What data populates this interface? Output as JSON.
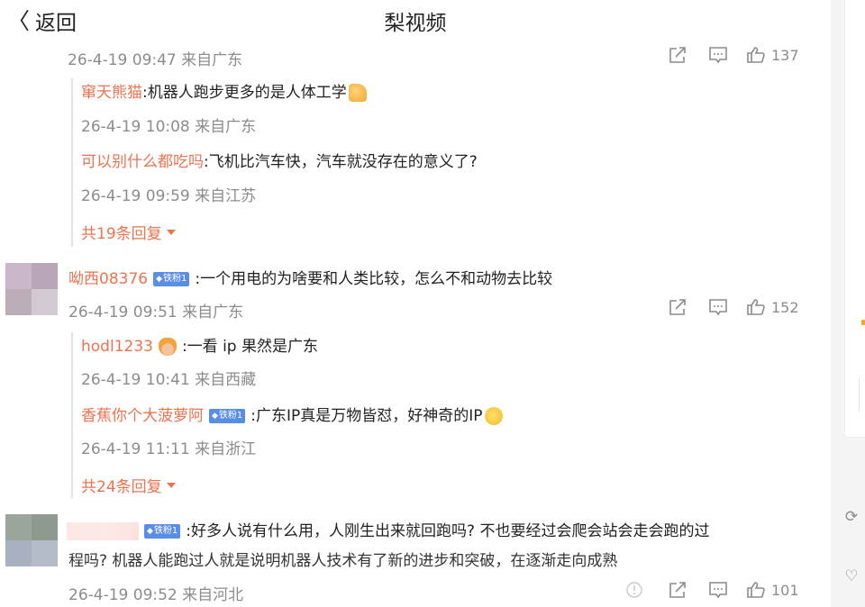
{
  "header": {
    "back_label": "返回",
    "title": "梨视频"
  },
  "comment1": {
    "time": "26-4-19 09:47 来自广东",
    "likes": "137",
    "replies": [
      {
        "name": "窜天熊猫",
        "text": ":机器人跑步更多的是人体工学",
        "time": "26-4-19 10:08 来自广东"
      },
      {
        "name": "可以别什么都吃吗",
        "text": ":飞机比汽车快，汽车就没存在的意义了?",
        "time": "26-4-19 09:59 来自江苏"
      }
    ],
    "more": "共19条回复"
  },
  "comment2": {
    "name": "呦西08376",
    "badge": "铁粉1",
    "text": ":一个用电的为啥要和人类比较，怎么不和动物去比较",
    "time": "26-4-19 09:51 来自广东",
    "likes": "152",
    "replies": [
      {
        "name": "hodl1233",
        "text": ":一看 ip 果然是广东",
        "time": "26-4-19 10:41 来自西藏"
      },
      {
        "name": "香蕉你个大菠萝阿",
        "badge": "铁粉1",
        "text": ":广东IP真是万物皆怼，好神奇的IP",
        "time": "26-4-19 11:11 来自浙江"
      }
    ],
    "more": "共24条回复"
  },
  "comment3": {
    "badge": "铁粉1",
    "text_line1": ":好多人说有什么用，人刚生出来就回跑吗? 不也要经过会爬会站会走会跑的过",
    "text_line2": "程吗? 机器人能跑过人就是说明机器人技术有了新的进步和突破，在逐渐走向成熟",
    "time": "26-4-19 09:52 来自河北",
    "likes": "101"
  },
  "icons": [
    "forward-icon",
    "comment-icon",
    "like-icon",
    "report-icon",
    "refresh-icon",
    "heart-icon"
  ],
  "colors": {
    "accent": "#eb7350",
    "badge": "#5a8de6",
    "muted": "#8c8c8c"
  }
}
